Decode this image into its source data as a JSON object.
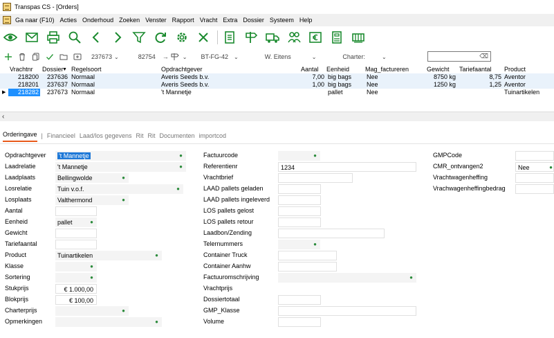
{
  "window": {
    "title": "Transpas CS - [Orders]"
  },
  "menu": [
    "Ga naar (F10)",
    "Acties",
    "Onderhoud",
    "Zoeken",
    "Venster",
    "Rapport",
    "Vracht",
    "Extra",
    "Dossier",
    "Systeem",
    "Help"
  ],
  "toolbar_icons": [
    "eye-icon",
    "mail-icon",
    "print-icon",
    "search-icon",
    "chevron-left-icon",
    "chevron-right-icon",
    "filter-icon",
    "refresh-icon",
    "gear-icon",
    "close-icon",
    "document-icon",
    "signpost-icon",
    "truck-icon",
    "people-icon",
    "euro-icon",
    "form-icon",
    "container-icon"
  ],
  "filterbar": {
    "order_id": "237673",
    "value2": "82754",
    "vehicle": "BT-FG-42",
    "driver": "W. Eitens",
    "charter_label": "Charter:",
    "search_placeholder": ""
  },
  "grid": {
    "columns": [
      "Vrachtnr",
      "Dossier",
      "Regelsoort",
      "Opdrachtgever",
      "Aantal",
      "Eenheid",
      "Mag_factureren",
      "Gewicht",
      "Tariefaantal",
      "Product"
    ],
    "rows": [
      {
        "vrachtnr": "218200",
        "dossier": "237636",
        "regelsoort": "Normaal",
        "opdrachtgever": "Averis Seeds b.v.",
        "aantal": "7,00",
        "eenheid": "big bags",
        "mag": "Nee",
        "gewicht": "8750 kg",
        "tarief": "8,75",
        "product": "Aventor"
      },
      {
        "vrachtnr": "218201",
        "dossier": "237637",
        "regelsoort": "Normaal",
        "opdrachtgever": "Averis Seeds b.v.",
        "aantal": "1,00",
        "eenheid": "big bags",
        "mag": "Nee",
        "gewicht": "1250 kg",
        "tarief": "1,25",
        "product": "Aventor"
      },
      {
        "vrachtnr": "218282",
        "dossier": "237673",
        "regelsoort": "Normaal",
        "opdrachtgever": "'t Mannetje",
        "aantal": "",
        "eenheid": "pallet",
        "mag": "Nee",
        "gewicht": "",
        "tarief": "",
        "product": "Tuinartikelen"
      }
    ]
  },
  "tabs": [
    "Orderingave",
    "Financieel",
    "Laad/los gegevens",
    "Rit",
    "Rit",
    "Documenten",
    "importcod"
  ],
  "tab_separator": "|",
  "form": {
    "col1": [
      {
        "label": "Opdrachtgever",
        "value": "'t Mannetje"
      },
      {
        "label": "Laadrelatie",
        "value": "'t Mannetje"
      },
      {
        "label": "Laadplaats",
        "value": "Bellingwolde"
      },
      {
        "label": "Losrelatie",
        "value": "Tuin v.o.f."
      },
      {
        "label": "Losplaats",
        "value": "Valthermond"
      },
      {
        "label": "Aantal",
        "value": ""
      },
      {
        "label": "Eenheid",
        "value": "pallet"
      },
      {
        "label": "Gewicht",
        "value": ""
      },
      {
        "label": "Tariefaantal",
        "value": ""
      },
      {
        "label": "Product",
        "value": "Tuinartikelen"
      },
      {
        "label": "Klasse",
        "value": ""
      },
      {
        "label": "Sortering",
        "value": ""
      },
      {
        "label": "Stukprijs",
        "value": "€ 1.000,00"
      },
      {
        "label": "Blokprijs",
        "value": "€ 100,00"
      },
      {
        "label": "Charterprijs",
        "value": ""
      },
      {
        "label": "Opmerkingen",
        "value": ""
      }
    ],
    "col2": [
      {
        "label": "Factuurcode",
        "value": ""
      },
      {
        "label": "Referentienr",
        "value": "1234"
      },
      {
        "label": "Vrachtbrief",
        "value": ""
      },
      {
        "label": "LAAD pallets geladen",
        "value": ""
      },
      {
        "label": "LAAD pallets ingeleverd",
        "value": ""
      },
      {
        "label": "LOS pallets gelost",
        "value": ""
      },
      {
        "label": "LOS pallets retour",
        "value": ""
      },
      {
        "label": "Laadbon/Zending",
        "value": ""
      },
      {
        "label": "Telernummers",
        "value": ""
      },
      {
        "label": "Container Truck",
        "value": ""
      },
      {
        "label": "Container Aanhw",
        "value": ""
      },
      {
        "label": "Factuuromschrijving",
        "value": ""
      },
      {
        "label": "Vrachtprijs",
        "value": ""
      },
      {
        "label": "Dossiertotaal",
        "value": ""
      },
      {
        "label": "GMP_Klasse",
        "value": ""
      },
      {
        "label": "Volume",
        "value": ""
      }
    ],
    "col3": [
      {
        "label": "GMPCode",
        "value": ""
      },
      {
        "label": "CMR_ontvangen2",
        "value": "Nee"
      },
      {
        "label": "Vrachtwagenheffing",
        "value": ""
      },
      {
        "label": "Vrachwagenheffingbedrag",
        "value": ""
      }
    ]
  },
  "colors": {
    "accent": "#1a8a2e",
    "selection": "#1e90ff",
    "active_tab": "#e85a1a"
  }
}
